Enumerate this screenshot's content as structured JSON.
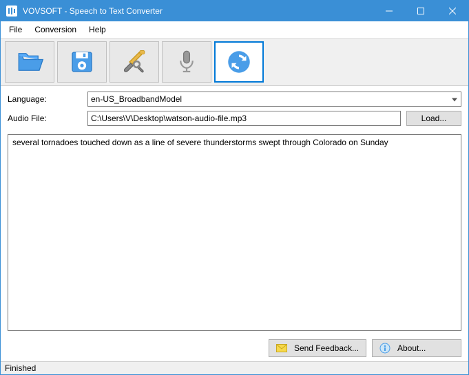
{
  "window": {
    "title": "VOVSOFT - Speech to Text Converter"
  },
  "menu": {
    "file": "File",
    "conversion": "Conversion",
    "help": "Help"
  },
  "form": {
    "language_label": "Language:",
    "language_value": "en-US_BroadbandModel",
    "audio_label": "Audio File:",
    "audio_value": "C:\\Users\\V\\Desktop\\watson-audio-file.mp3",
    "load_label": "Load..."
  },
  "transcript": "several tornadoes touched down as a line of severe thunderstorms swept through Colorado on Sunday",
  "buttons": {
    "feedback": "Send Feedback...",
    "about": "About..."
  },
  "status": "Finished"
}
